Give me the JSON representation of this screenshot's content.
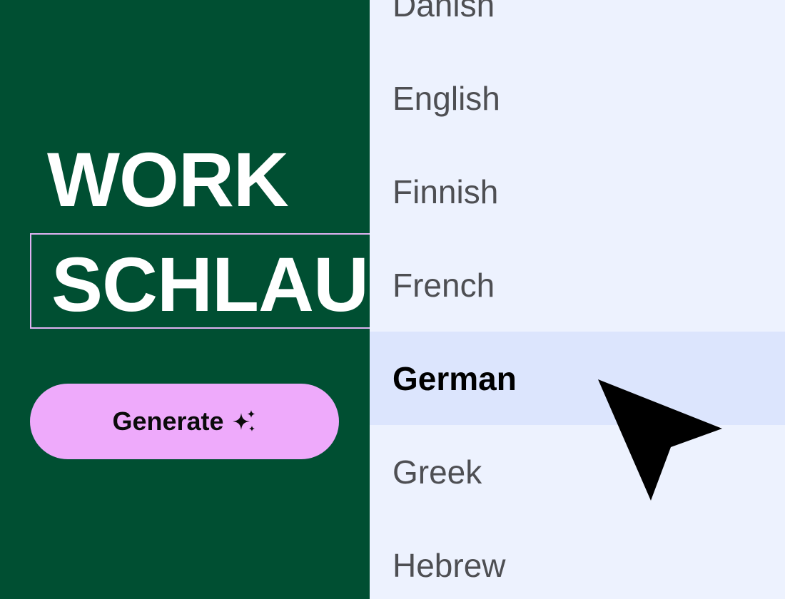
{
  "hero": {
    "headline_line1": "WORK",
    "headline_line2": "SCHLAU",
    "generate_label": "Generate"
  },
  "language_menu": {
    "items": [
      {
        "label": "Danish",
        "selected": false
      },
      {
        "label": "English",
        "selected": false
      },
      {
        "label": "Finnish",
        "selected": false
      },
      {
        "label": "French",
        "selected": false
      },
      {
        "label": "German",
        "selected": true
      },
      {
        "label": "Greek",
        "selected": false
      },
      {
        "label": "Hebrew",
        "selected": false
      }
    ]
  },
  "icons": {
    "generate": "sparkle-icon",
    "cursor": "mouse-pointer-icon"
  },
  "colors": {
    "background": "#004f32",
    "button": "#eeaafb",
    "selection_outline": "#e0b2f2",
    "menu_background": "#edf2fe",
    "menu_highlight": "#dce5fd"
  }
}
